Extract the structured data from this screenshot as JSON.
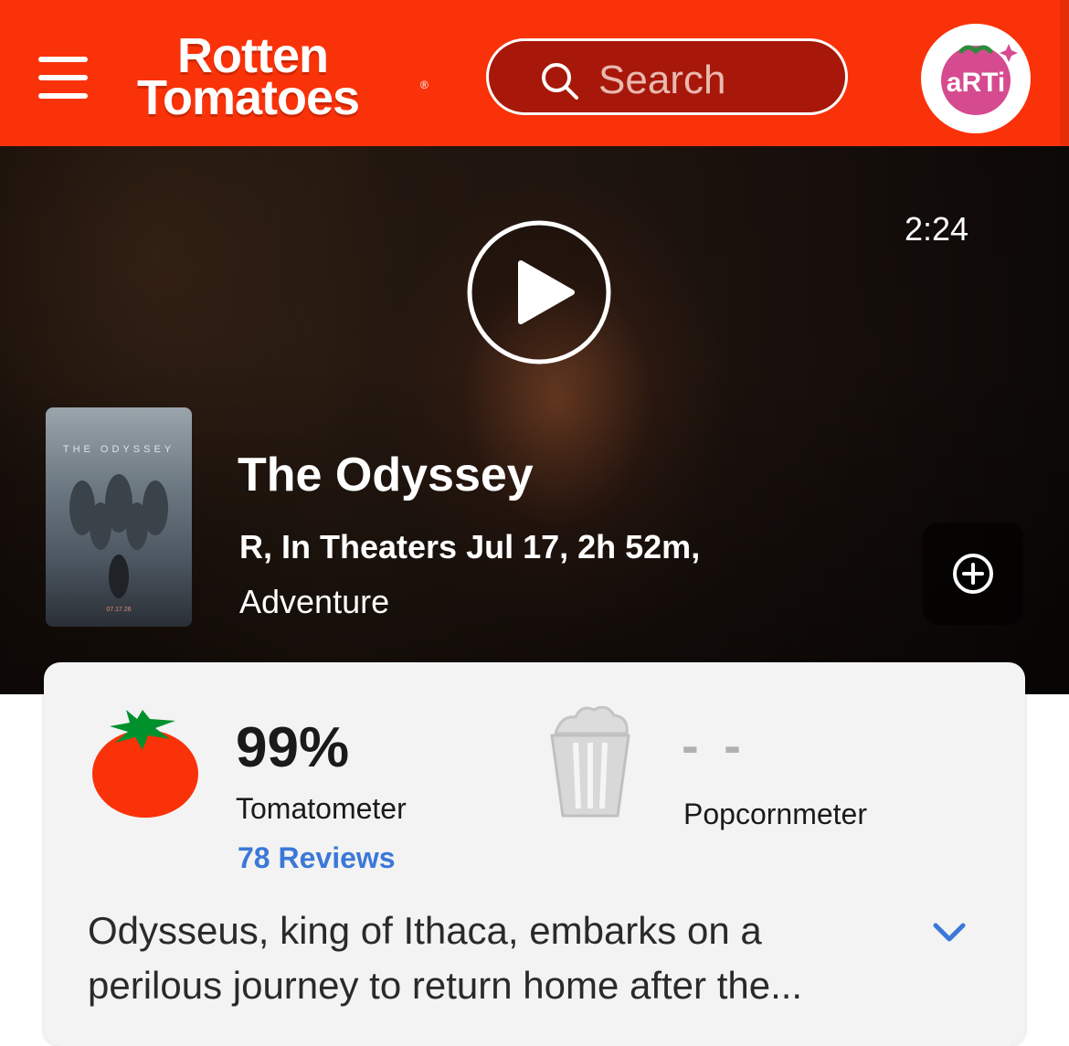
{
  "header": {
    "logo_line1": "Rotten",
    "logo_line2": "Tomatoes",
    "logo_reg": "®",
    "search_placeholder": "Search",
    "avatar_text": "aRTi",
    "colors": {
      "brand": "#fa320a",
      "search_bg": "#a7180a"
    }
  },
  "hero": {
    "duration": "2:24",
    "poster_title": "THE ODYSSEY",
    "poster_date": "07.17.26",
    "title": "The Odyssey",
    "meta": "R, In Theaters Jul 17, 2h 52m,",
    "genre": "Adventure",
    "icons": {
      "play": "play-icon",
      "add": "add-circle-icon"
    }
  },
  "scores": {
    "tomatometer": {
      "value": "99%",
      "label": "Tomatometer",
      "reviews": "78 Reviews",
      "icon": "tomato-icon"
    },
    "popcornmeter": {
      "value": "- -",
      "label": "Popcornmeter",
      "icon": "popcorn-bucket-icon"
    },
    "link_color": "#3b78d8"
  },
  "synopsis": {
    "text": "Odysseus, king of Ithaca, embarks on a perilous journey to return home after the...",
    "expand_icon": "chevron-down-icon"
  }
}
